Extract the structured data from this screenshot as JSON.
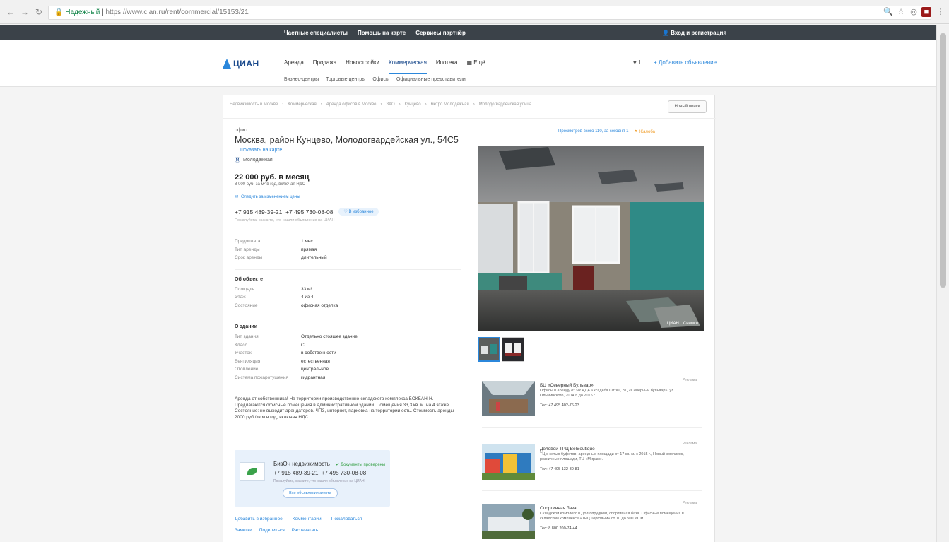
{
  "browser": {
    "secure_label": "Надежный",
    "url": "https://www.cian.ru/rent/commercial/15153/21"
  },
  "topbar": {
    "links": [
      "Частные специалисты",
      "Помощь на карте",
      "Сервисы партнёр"
    ],
    "login": "Вход и регистрация"
  },
  "header": {
    "logo": "ЦИАН",
    "nav": [
      "Аренда",
      "Продажа",
      "Новостройки",
      "Коммерческая",
      "Ипотека",
      "Ещё"
    ],
    "active_nav": "Коммерческая",
    "favorites": "♥ 1",
    "add_ad": "+ Добавить объявление",
    "subnav": [
      "Бизнес-центры",
      "Торговые центры",
      "Офисы",
      "Официальные представители"
    ]
  },
  "card": {
    "breadcrumb": [
      "Недвижимость в Москве",
      "Коммерческая",
      "Аренда офисов в Москве",
      "ЗАО",
      "Кунцево",
      "метро Молодежная",
      "Молодогвардейская улица"
    ],
    "new_search": "Новый поиск",
    "type": "офис",
    "address": "Москва, район Кунцево, Молодогвардейская ул., 54С5",
    "map_link": "Показать на карте",
    "metro": "Молодежная",
    "price": "22 000 руб. в месяц",
    "price_sub": "8 000 руб. за м² в год, включая НДС",
    "price_watch": "Следить за изменением цены",
    "phones": "+7 915 489-39-21, +7 495 730-08-08",
    "fav_badge": "В избранное",
    "phone_note": "Пожалуйста, скажите, что нашли объявление на ЦИАН",
    "terms": [
      {
        "k": "Предоплата",
        "v": "1 мес."
      },
      {
        "k": "Тип аренды",
        "v": "прямая"
      },
      {
        "k": "Срок аренды",
        "v": "длительный"
      }
    ],
    "object_title": "Об объекте",
    "object": [
      {
        "k": "Площадь",
        "v": "33 м²"
      },
      {
        "k": "Этаж",
        "v": "4 из 4"
      },
      {
        "k": "Состояние",
        "v": "офисная отделка"
      }
    ],
    "building_title": "О здании",
    "building": [
      {
        "k": "Тип здания",
        "v": "Отдельно стоящее здание"
      },
      {
        "k": "Класс",
        "v": "С"
      },
      {
        "k": "Участок",
        "v": "в собственности"
      },
      {
        "k": "Вентиляция",
        "v": "естественная"
      },
      {
        "k": "Отопление",
        "v": "центральное"
      },
      {
        "k": "Система пожаротушения",
        "v": "гидрантная"
      }
    ],
    "description": "Аренда от собственника! На территории производственно-складского комплекса БОКБАН-Н. Предлагаются офисные помещения в административном здании. Помещения 33,3 кв. м. на 4 этаже. Состояние: не выходит арендаторов. ЧПЗ, интернет, парковка на территории есть. Стоимость аренды 2000 руб./кв.м в год, включая НДС.",
    "agent": {
      "name": "БизОн недвижимость",
      "checked": "Документы проверены",
      "phones": "+7 915 489-39-21, +7 495 730-08-08",
      "note": "Пожалуйста, скажите, что нашли объявление на ЦИАН",
      "all_ads": "Все объявления агента"
    },
    "actions": [
      "Добавить в избранное",
      "Комментарий",
      "Пожаловаться"
    ],
    "actions2": [
      "Заметки",
      "Поделиться",
      "Распечатать"
    ],
    "stats": "Просмотров всего 110, за сегодня 1",
    "complain": "Жалоба",
    "photo_caption": [
      "ЦИАН",
      "Снимки"
    ],
    "similar": [
      {
        "title": "БЦ «Северный Бульвар»",
        "desc": "Офисы в аренду от ЧУЖДА «Усадьба Сити», БЦ «Северный бульвар», ул. Ольминского, 2014 г. до 2015 г.",
        "phone": "Тел: +7 495 402-76-23",
        "tag": "Реклама"
      },
      {
        "title": "Деловой ТРЦ BelBoutique",
        "desc": "ТЦ с сетью буфетов, арендные площади от 17 кв. м. с 2015 г., Новый комплекс, розничные площади, ТЦ «Мираж».",
        "phone": "Тел: +7 495 132-30-81",
        "tag": "Реклама"
      },
      {
        "title": "Спортивная база",
        "desc": "Складской комплекс в Долгопрудном, спортивная база. Офисные помещения в складском комплексе «ТРЦ Торговый» от 10 до 500 кв. м.",
        "phone": "Тел: 8 800 200-74-44",
        "tag": "Реклама"
      }
    ]
  },
  "colors": {
    "accent": "#2b87db",
    "topbar": "#3b4249",
    "brand_dark": "#1a4a8c",
    "agent_bg": "#e8f1fb"
  }
}
